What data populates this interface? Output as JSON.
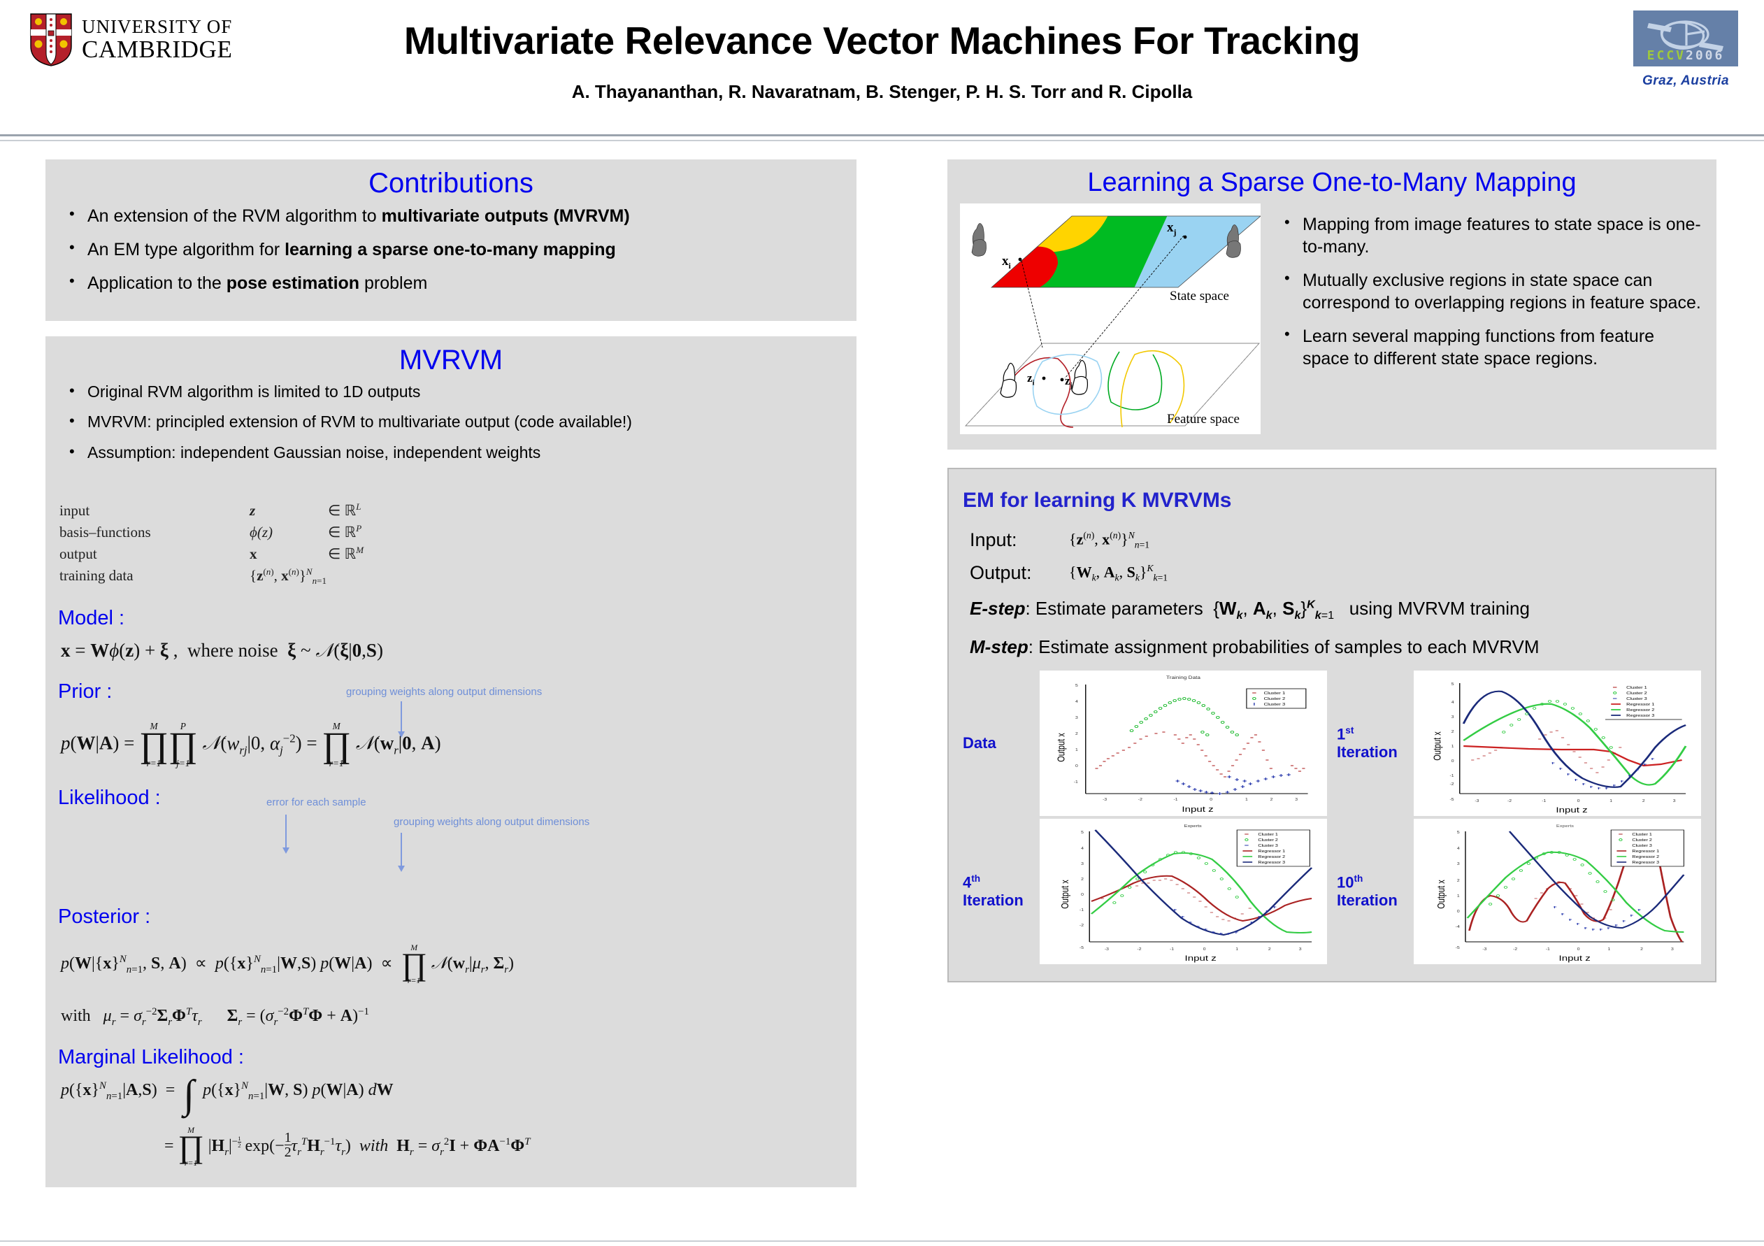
{
  "header": {
    "university_line1": "UNIVERSITY OF",
    "university_line2": "CAMBRIDGE",
    "title": "Multivariate Relevance Vector Machines For Tracking",
    "authors": "A. Thayananthan, R. Navaratnam,  B. Stenger, P. H. S. Torr and R. Cipolla",
    "conference_logo_eccv": "ECCV",
    "conference_logo_year": "2006",
    "conference_city": "Graz,  Austria",
    "accent_blue": "#0000ee",
    "logo_blue": "#6580a8"
  },
  "contributions": {
    "heading": "Contributions",
    "bullets": [
      {
        "pre": "An extension of the RVM algorithm to ",
        "bold": "multivariate outputs (MVRVM)",
        "post": ""
      },
      {
        "pre": "An EM type algorithm for ",
        "bold": "learning a sparse one-to-many mapping",
        "post": ""
      },
      {
        "pre": "Application to the ",
        "bold": "pose estimation",
        "post": " problem"
      }
    ]
  },
  "mvrvm": {
    "heading": "MVRVM",
    "bullets": [
      "Original RVM algorithm is limited to 1D outputs",
      "MVRVM: principled extension of RVM to multivariate output (code available!)",
      "Assumption: independent Gaussian noise, independent weights"
    ],
    "definitions": [
      {
        "name": "input",
        "sym": "z",
        "space": "∈ ℝ",
        "dim": "L"
      },
      {
        "name": "basis–functions",
        "sym": "ϕ(z)",
        "space": "∈ ℝ",
        "dim": "P"
      },
      {
        "name": "output",
        "sym": "x",
        "space": "∈ ℝ",
        "dim": "M"
      },
      {
        "name": "training  data",
        "sym": "{z",
        "space": "",
        "dim": ""
      }
    ],
    "training_data_expr": "{z(n), x(n)}N n=1",
    "sections": {
      "model_label": "Model  :",
      "model_eq": "x = Wϕ(z) + ξ ,  where noise  ξ ~ ᵊ(ξ|0, S)",
      "prior_label": "Prior :",
      "prior_annotation": "grouping weights along output dimensions",
      "likelihood_label": "Likelihood :",
      "likelihood_annotation_1": "error for each sample",
      "likelihood_annotation_2": "grouping weights along output dimensions",
      "posterior_label": "Posterior :",
      "with_label": "with",
      "marginal_label": "Marginal Likelihood :"
    }
  },
  "sparse": {
    "heading": "Learning a Sparse One-to-Many Mapping",
    "diagram": {
      "state_space_label": "State space",
      "feature_space_label": "Feature space",
      "point_xi": "x",
      "point_xi_sub": "i",
      "point_xj": "x",
      "point_xj_sub": "j",
      "point_zi": "z",
      "point_zi_sub": "i",
      "point_zj": "z",
      "point_zj_sub": "j",
      "region_colors": [
        "#ee0000",
        "#ffd400",
        "#00bb22",
        "#9ad3f2"
      ]
    },
    "bullets": [
      "Mapping from image features to state space is one-to-many.",
      "Mutually exclusive regions in state space can correspond to overlapping regions in feature space.",
      "Learn several mapping functions from feature space to different state space regions."
    ]
  },
  "em": {
    "heading": "EM for learning K MVRVMs",
    "input_label": "Input:",
    "input_expr": "{z(n), x(n)}N n=1",
    "output_label": "Output:",
    "output_expr": "{Wk, Ak, Sk}K k=1",
    "estep_name": "E-step",
    "estep_text_1": ": Estimate parameters",
    "estep_expr": "{Wk, Ak, Sk}K k=1",
    "estep_text_2": "using MVRVM training",
    "mstep_name": "M-step",
    "mstep_text": ": Estimate assignment probabilities of samples to each MVRVM"
  },
  "plot_tags": {
    "data": "Data",
    "iter1": "1st Iteration",
    "iter1_sup": "st",
    "iter4": "4th Iteration",
    "iter10": "10th Iteration"
  },
  "chart_data": [
    {
      "type": "scatter",
      "title": "Training Data",
      "xlabel": "Input z",
      "ylabel": "Output x",
      "xlim": [
        -3,
        3
      ],
      "ylim": [
        -5,
        5
      ],
      "xticks": [
        -3,
        -2,
        -1,
        0,
        1,
        2,
        3
      ],
      "yticks": [
        -5,
        -4,
        -3,
        -2,
        -1,
        0,
        1,
        2,
        3,
        4,
        5
      ],
      "grid": false,
      "legend_position": "top-right",
      "legend": [
        "Cluster 1",
        "Cluster 2",
        "Cluster 3"
      ],
      "series": [
        {
          "name": "Cluster 1",
          "color": "#aa1111",
          "marker": "x",
          "comment": "red cluster, two descending/ascending arcs",
          "x": [
            -3.0,
            -2.85,
            -2.7,
            -2.55,
            -2.4,
            -2.2,
            -2.0,
            -1.85,
            -1.0,
            -0.9,
            -0.8,
            -0.7,
            -0.6,
            -0.5,
            -0.4,
            -0.3,
            -0.2,
            -0.1,
            0.0,
            0.1,
            0.2,
            0.35,
            0.5,
            0.65,
            0.8,
            0.95,
            1.1,
            1.3,
            1.5,
            2.6,
            2.75,
            2.9,
            3.0
          ],
          "y": [
            -0.1,
            0.2,
            0.45,
            0.7,
            0.9,
            1.05,
            1.3,
            1.9,
            2.0,
            1.75,
            1.6,
            1.55,
            1.35,
            1.1,
            0.7,
            0.3,
            -0.1,
            -0.35,
            -0.55,
            -0.9,
            -1.15,
            -0.75,
            -0.35,
            0.0,
            0.4,
            0.85,
            1.3,
            1.75,
            1.95,
            0.05,
            -0.15,
            -0.35,
            -0.2
          ]
        },
        {
          "name": "Cluster 2",
          "color": "#22bb33",
          "marker": "o",
          "comment": "green cluster, broad arch",
          "x": [
            -2.5,
            -2.35,
            -2.2,
            -2.05,
            -1.9,
            -1.75,
            -1.6,
            -1.45,
            -1.3,
            -1.15,
            -1.0,
            -0.85,
            -0.7,
            -0.55,
            -0.4,
            -0.25,
            -0.1,
            0.05,
            0.2,
            0.35,
            0.5,
            0.65,
            0.8,
            0.95,
            1.1
          ],
          "y": [
            2.2,
            2.5,
            2.75,
            3.0,
            3.25,
            3.45,
            3.7,
            3.9,
            4.05,
            4.2,
            4.3,
            4.25,
            4.2,
            4.1,
            3.95,
            3.8,
            3.6,
            3.35,
            3.1,
            2.85,
            2.6,
            2.35,
            2.15,
            2.0,
            1.9
          ]
        },
        {
          "name": "Cluster 3",
          "color": "#2233aa",
          "marker": "+",
          "comment": "blue cluster, deep valley",
          "x": [
            -1.0,
            -0.9,
            -0.8,
            -0.7,
            -0.6,
            -0.5,
            -0.4,
            -0.3,
            -0.2,
            -0.1,
            0.0,
            0.15,
            0.3,
            0.45,
            0.6,
            0.75,
            0.9,
            1.05,
            1.2,
            1.4,
            1.6,
            1.8,
            2.0,
            2.2,
            2.4,
            2.6,
            2.8
          ],
          "y": [
            -1.25,
            -1.55,
            -1.9,
            -2.2,
            -2.55,
            -2.85,
            -3.15,
            -3.45,
            -3.65,
            -3.85,
            -3.95,
            -4.1,
            -4.15,
            -4.1,
            -3.95,
            -3.8,
            -3.6,
            -3.35,
            -3.05,
            -2.7,
            -2.4,
            -2.05,
            -1.8,
            -1.55,
            -1.4,
            -1.25,
            -1.15
          ]
        }
      ]
    },
    {
      "type": "scatter",
      "title": "",
      "xlabel": "Input z",
      "ylabel": "Output x",
      "xlim": [
        -3,
        3
      ],
      "ylim": [
        -5,
        5
      ],
      "xticks": [
        -3,
        -2,
        -1,
        0,
        1,
        2,
        3
      ],
      "yticks": [
        -5,
        -4,
        -3,
        -2,
        -1,
        0,
        1,
        2,
        3,
        4,
        5
      ],
      "grid": false,
      "legend_position": "top-right",
      "legend": [
        "Cluster 1",
        "Cluster 2",
        "Cluster 3",
        "Regressor 1",
        "Regressor 2",
        "Regressor 3"
      ],
      "regressors": [
        {
          "name": "Regressor 1",
          "color": "#cc2222",
          "x": [
            -3,
            -2.5,
            -2,
            -1.5,
            -1,
            -0.5,
            0,
            0.5,
            1,
            1.5,
            2,
            2.5,
            3
          ],
          "y": [
            1.0,
            0.92,
            0.85,
            0.8,
            0.78,
            0.75,
            0.72,
            0.7,
            0.68,
            0.45,
            0.1,
            -0.45,
            -0.1
          ]
        },
        {
          "name": "Regressor 2",
          "color": "#33cc44",
          "x": [
            -3,
            -2.5,
            -2,
            -1.5,
            -1,
            -0.5,
            0,
            0.5,
            1,
            1.5,
            2,
            2.5,
            3
          ],
          "y": [
            1.5,
            2.1,
            3.05,
            3.7,
            3.9,
            3.55,
            2.6,
            1.4,
            0.4,
            -1.0,
            -2.3,
            -2.8,
            -1.9
          ]
        },
        {
          "name": "Regressor 3",
          "color": "#1a2a7a",
          "x": [
            -3,
            -2.7,
            -2.4,
            -2,
            -1.5,
            -1,
            -0.5,
            0,
            0.5,
            1,
            1.5,
            2,
            2.5,
            3
          ],
          "y": [
            3.9,
            4.6,
            4.5,
            3.1,
            1.2,
            -0.3,
            -1.6,
            -2.4,
            -3.0,
            -3.4,
            -3.55,
            -2.1,
            -0.1,
            1.8
          ]
        }
      ]
    },
    {
      "type": "scatter",
      "title": "Experts",
      "xlabel": "Input  z",
      "ylabel": "Output x",
      "xlim": [
        -3,
        3
      ],
      "ylim": [
        -5,
        5
      ],
      "xticks": [
        -3,
        -2,
        -1,
        0,
        1,
        2,
        3
      ],
      "yticks": [
        -5,
        -4,
        -3,
        -2,
        -1,
        0,
        1,
        2,
        3,
        4,
        5
      ],
      "grid": false,
      "legend_position": "top-right",
      "legend": [
        "Cluster 1",
        "Cluster 2",
        "Cluster 3",
        "Regressor 1",
        "Regressor 2",
        "Regressor 3"
      ],
      "regressors": [
        {
          "name": "Regressor 1",
          "color": "#aa2222",
          "x": [
            -3,
            -2.5,
            -2,
            -1.5,
            -1,
            -0.5,
            0,
            0.5,
            1,
            1.5,
            2,
            2.5,
            3
          ],
          "y": [
            0.25,
            0.8,
            1.6,
            2.1,
            2.0,
            1.2,
            0.1,
            -0.9,
            -1.4,
            -1.4,
            -0.9,
            -0.3,
            -0.05
          ]
        },
        {
          "name": "Regressor 2",
          "color": "#33cc44",
          "x": [
            -3,
            -2.5,
            -2,
            -1.5,
            -1,
            -0.5,
            0,
            0.5,
            1,
            1.5,
            2,
            2.5,
            3
          ],
          "y": [
            -1.1,
            0.6,
            2.0,
            3.2,
            3.85,
            4.0,
            3.5,
            2.5,
            1.0,
            -0.8,
            -2.4,
            -3.2,
            -3.3
          ]
        },
        {
          "name": "Regressor 3",
          "color": "#1a2a7a",
          "x": [
            -2.8,
            -2.4,
            -2,
            -1.6,
            -1.2,
            -0.8,
            -0.4,
            0,
            0.4,
            0.8,
            1.2,
            1.6,
            2,
            2.4,
            2.8
          ],
          "y": [
            5.0,
            3.6,
            2.2,
            0.8,
            -0.5,
            -1.6,
            -2.4,
            -3.0,
            -3.4,
            -3.6,
            -3.5,
            -3.0,
            -2.1,
            -0.8,
            0.8
          ]
        }
      ]
    },
    {
      "type": "scatter",
      "title": "Experts",
      "xlabel": "Input z",
      "ylabel": "Output x",
      "xlim": [
        -3,
        3
      ],
      "ylim": [
        -5,
        5
      ],
      "xticks": [
        -3,
        -2,
        -1,
        0,
        1,
        2,
        3
      ],
      "yticks": [
        -5,
        -4,
        -3,
        -2,
        -1,
        0,
        1,
        2,
        3,
        4,
        5
      ],
      "grid": false,
      "legend_position": "top-right",
      "legend": [
        "Cluster 1",
        "Cluster 2",
        "Cluster 3",
        "Regressor 1",
        "Regressor 2",
        "Regressor 3"
      ],
      "regressors": [
        {
          "name": "Regressor 1",
          "color": "#aa2222",
          "x": [
            -3,
            -2.75,
            -2.5,
            -2.2,
            -1.9,
            -1.6,
            -1.3,
            -1.0,
            -0.7,
            -0.4,
            -0.1,
            0.2,
            0.5,
            0.8,
            1.0,
            1.2,
            1.45,
            2.6,
            2.8,
            3.0
          ],
          "y": [
            -3.2,
            -1.0,
            0.6,
            0.85,
            0.1,
            -1.4,
            -2.2,
            -1.0,
            1.2,
            2.0,
            1.2,
            -0.2,
            -1.5,
            -2.35,
            -2.0,
            -0.6,
            2.4,
            0.3,
            -2.3,
            -5.0
          ]
        },
        {
          "name": "Regressor 2",
          "color": "#33cc44",
          "x": [
            -3,
            -2.5,
            -2,
            -1.5,
            -1,
            -0.5,
            0,
            0.5,
            1,
            1.5,
            2,
            2.5,
            3
          ],
          "y": [
            -1.5,
            0.8,
            2.5,
            3.5,
            4.05,
            3.95,
            3.35,
            2.3,
            1.0,
            -0.5,
            -2.0,
            -3.0,
            -3.5
          ]
        },
        {
          "name": "Regressor 3",
          "color": "#1a2a7a",
          "x": [
            -2.5,
            -2.2,
            -1.9,
            -1.6,
            -1.3,
            -1.0,
            -0.6,
            -0.2,
            0.2,
            0.6,
            1.0,
            1.4,
            1.8,
            2.2,
            2.6,
            3.0
          ],
          "y": [
            5.0,
            4.0,
            3.0,
            2.0,
            1.0,
            0.0,
            -1.2,
            -2.2,
            -3.0,
            -3.6,
            -3.9,
            -3.85,
            -3.4,
            -2.5,
            -1.4,
            0.9
          ]
        }
      ]
    }
  ]
}
